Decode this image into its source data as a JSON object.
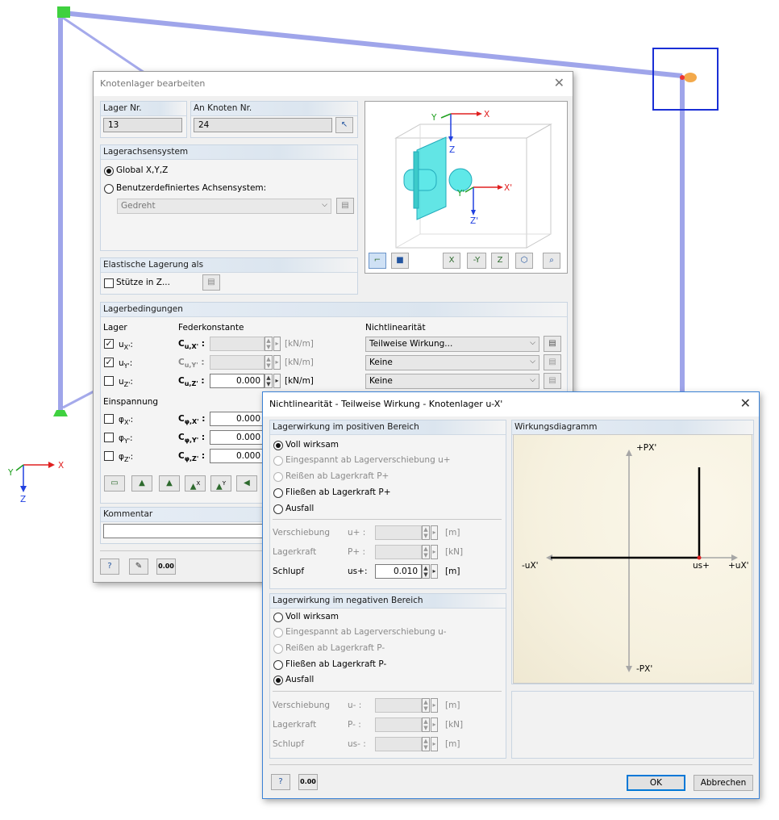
{
  "scene": {
    "axis_labels": {
      "x": "X",
      "y": "Y",
      "z": "Z"
    }
  },
  "dialog_main": {
    "title": "Knotenlager bearbeiten",
    "lager_nr": {
      "header": "Lager Nr.",
      "value": "13"
    },
    "an_knoten": {
      "header": "An Knoten Nr.",
      "value": "24"
    },
    "achsensystem": {
      "header": "Lagerachsensystem",
      "option_global": "Global X,Y,Z",
      "option_user": "Benutzerdefiniertes Achsensystem:",
      "combo_value": "Gedreht"
    },
    "elastisch": {
      "header": "Elastische Lagerung als",
      "stuetze": "Stütze in Z..."
    },
    "preview": {
      "x": "X",
      "y": "Y",
      "z": "Z",
      "x2": "X'",
      "y2": "Y'",
      "z2": "Z'",
      "tb_x": "X",
      "tb_y": "-Y",
      "tb_z": "Z"
    },
    "bedingungen": {
      "header": "Lagerbedingungen",
      "col_lager": "Lager",
      "col_feder": "Federkonstante",
      "col_nonlin": "Nichtlinearität",
      "rows": [
        {
          "check": "u",
          "sub": "X'",
          "const": "C",
          "csub": "u,X'",
          "value": "",
          "unit": "[kN/m]",
          "nonlin": "Teilweise Wirkung..."
        },
        {
          "check": "u",
          "sub": "Y'",
          "const": "C",
          "csub": "u,Y'",
          "value": "",
          "unit": "[kN/m]",
          "nonlin": "Keine"
        },
        {
          "check": "u",
          "sub": "Z'",
          "const": "C",
          "csub": "u,Z'",
          "value": "0.000",
          "unit": "[kN/m]",
          "nonlin": "Keine"
        }
      ],
      "einspannung": "Einspannung",
      "rot_rows": [
        {
          "check": "φ",
          "sub": "X'",
          "const": "C",
          "csub": "φ,X'",
          "value": "0.000"
        },
        {
          "check": "φ",
          "sub": "Y'",
          "const": "C",
          "csub": "φ,Y'",
          "value": "0.000"
        },
        {
          "check": "φ",
          "sub": "Z'",
          "const": "C",
          "csub": "φ,Z'",
          "value": "0.000"
        }
      ],
      "tb_labels": [
        "X",
        "Y"
      ]
    },
    "kommentar": {
      "header": "Kommentar",
      "value": ""
    },
    "footer_num": "0.00"
  },
  "dialog_nl": {
    "title": "Nichtlinearität - Teilweise Wirkung - Knotenlager u-X'",
    "pos": {
      "header": "Lagerwirkung im positiven Bereich",
      "options": [
        "Voll wirksam",
        "Eingespannt ab Lagerverschiebung u+",
        "Reißen ab Lagerkraft P+",
        "Fließen ab Lagerkraft P+",
        "Ausfall"
      ],
      "verschiebung": {
        "label": "Verschiebung",
        "sym": "u+",
        "value": "",
        "unit": "[m]"
      },
      "lagerkraft": {
        "label": "Lagerkraft",
        "sym": "P+",
        "value": "",
        "unit": "[kN]"
      },
      "schlupf": {
        "label": "Schlupf",
        "sym": "us+",
        "value": "0.010",
        "unit": "[m]"
      }
    },
    "neg": {
      "header": "Lagerwirkung im negativen Bereich",
      "options": [
        "Voll wirksam",
        "Eingespannt ab Lagerverschiebung u-",
        "Reißen ab Lagerkraft P-",
        "Fließen ab Lagerkraft P-",
        "Ausfall"
      ],
      "verschiebung": {
        "label": "Verschiebung",
        "sym": "u-",
        "value": "",
        "unit": "[m]"
      },
      "lagerkraft": {
        "label": "Lagerkraft",
        "sym": "P-",
        "value": "",
        "unit": "[kN]"
      },
      "schlupf": {
        "label": "Schlupf",
        "sym": "us-",
        "value": "",
        "unit": "[m]"
      }
    },
    "diagram": {
      "header": "Wirkungsdiagramm",
      "top": "+PX'",
      "bottom": "-PX'",
      "left": "-uX'",
      "right": "+uX'",
      "us": "us+"
    },
    "ok": "OK",
    "cancel": "Abbrechen",
    "footer_num": "0.00"
  }
}
